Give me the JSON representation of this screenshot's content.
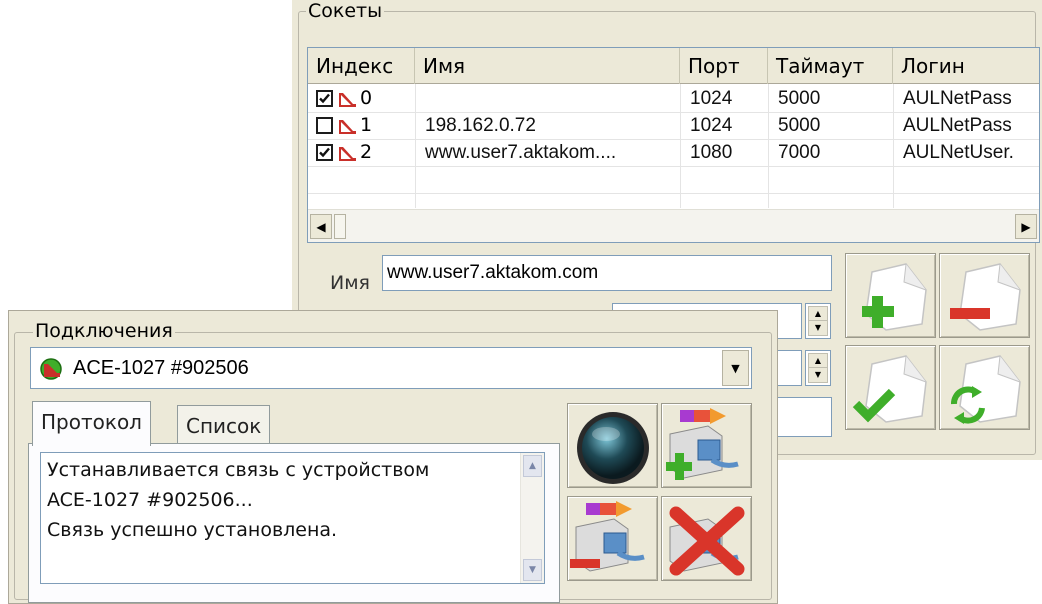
{
  "sockets": {
    "title": "Сокеты",
    "columns": [
      "Индекс",
      "Имя",
      "Порт",
      "Таймаут",
      "Логин"
    ],
    "rows": [
      {
        "checked": true,
        "index": "0",
        "name": "",
        "port": "1024",
        "timeout": "5000",
        "login": "AULNetPass"
      },
      {
        "checked": false,
        "index": "1",
        "name": "198.162.0.72",
        "port": "1024",
        "timeout": "5000",
        "login": "AULNetPass"
      },
      {
        "checked": true,
        "index": "2",
        "name": "www.user7.aktakom....",
        "port": "1080",
        "timeout": "7000",
        "login": "AULNetUser."
      }
    ],
    "name_label": "Имя",
    "name_value": "www.user7.aktakom.com"
  },
  "connections": {
    "title": "Подключения",
    "selected_device": "ACE-1027 #902506",
    "tabs": [
      "Протокол",
      "Список"
    ],
    "log_lines": [
      "Устанавливается связь с устройством",
      "ACE-1027 #902506...",
      "Связь успешно установлена."
    ]
  },
  "colors": {
    "window_bg": "#ece9d8",
    "border": "#7f9db9",
    "add_green": "#3fae2a",
    "remove_red": "#d9352a"
  }
}
